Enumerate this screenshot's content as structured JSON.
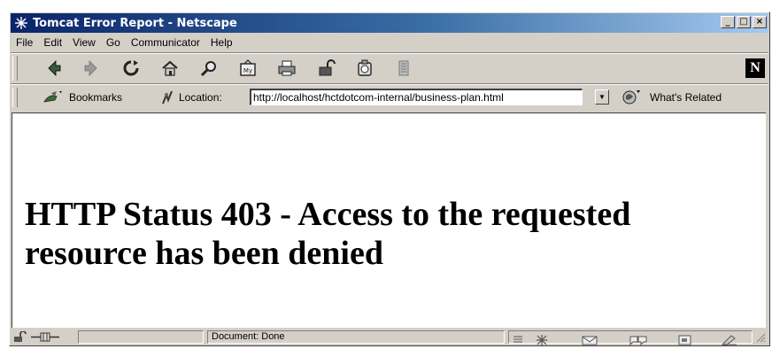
{
  "window": {
    "title": "Tomcat Error Report - Netscape",
    "controls": {
      "minimize": "_",
      "maximize": "□",
      "close": "×"
    }
  },
  "menu": [
    "File",
    "Edit",
    "View",
    "Go",
    "Communicator",
    "Help"
  ],
  "toolbar": {
    "icons": [
      "back-icon",
      "forward-icon",
      "reload-icon",
      "home-icon",
      "search-icon",
      "netscape-guide-icon",
      "print-icon",
      "security-icon",
      "shop-icon",
      "stop-icon"
    ],
    "logo": "N"
  },
  "location_bar": {
    "bookmarks_label": "Bookmarks",
    "location_label": "Location:",
    "url": "http://localhost/hctdotcom-internal/business-plan.html",
    "whats_related_label": "What's Related"
  },
  "page": {
    "heading": "HTTP Status 403 - Access to the requested resource has been denied"
  },
  "status_bar": {
    "status_text": "Document: Done"
  },
  "colors": {
    "titlebar_start": "#0a246a",
    "titlebar_end": "#a6caf0",
    "chrome": "#d4d0c8"
  }
}
